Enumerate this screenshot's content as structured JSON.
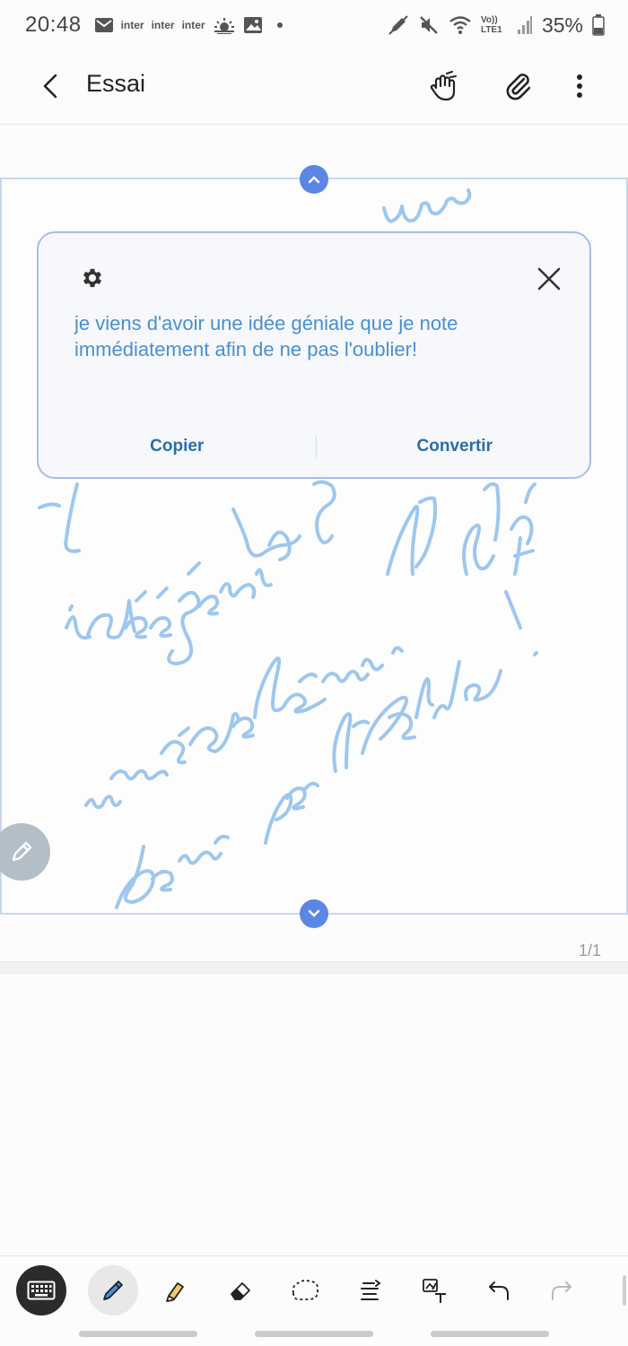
{
  "status_bar": {
    "time": "20:48",
    "carrier_labels": [
      "inter",
      "inter",
      "inter"
    ],
    "network": "Vo)) LTE1",
    "battery": "35%",
    "icons": [
      "mail-icon",
      "weather-icon",
      "image-icon",
      "pen-icon",
      "mute-icon",
      "wifi-icon",
      "signal-icon",
      "battery-icon"
    ]
  },
  "app_bar": {
    "title": "Essai",
    "icons": [
      "back-icon",
      "touch-draw-icon",
      "attachment-icon",
      "more-vert-icon"
    ]
  },
  "popup": {
    "recognized_text": "je viens d'avoir une idée géniale que je note immédiatement afin de ne pas l'oublier!",
    "copy_label": "Copier",
    "convert_label": "Convertir",
    "icons": [
      "settings-icon",
      "close-icon"
    ]
  },
  "page": {
    "indicator": "1/1",
    "ink_color": "#9ec7ee"
  },
  "toolbar": {
    "tools": [
      "keyboard-icon",
      "pen-icon",
      "highlighter-icon",
      "eraser-icon",
      "lasso-icon",
      "text-align-icon",
      "text-image-icon",
      "undo-icon",
      "redo-icon"
    ]
  },
  "colors": {
    "accent": "#5b86e5",
    "popup_text": "#4a8fcf",
    "popup_button": "#2c6ea6",
    "frame_border": "#c8d7ef"
  }
}
